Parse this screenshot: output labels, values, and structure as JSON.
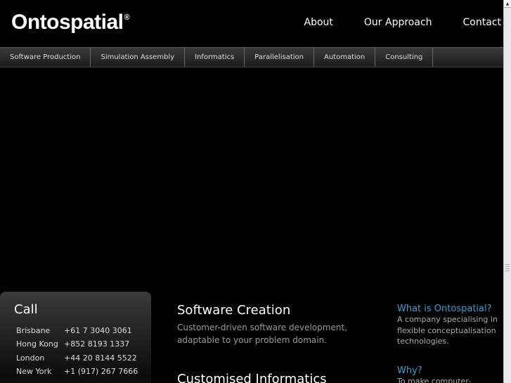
{
  "header": {
    "logo": "Ontospatial",
    "logo_mark": "®",
    "links": [
      "About",
      "Our Approach",
      "Contact"
    ]
  },
  "nav": [
    "Software Production",
    "Simulation Assembly",
    "Informatics",
    "Parallelisation",
    "Automation",
    "Consulting"
  ],
  "call": {
    "title": "Call",
    "rows": [
      {
        "city": "Brisbane",
        "phone": "+61 7 3040 3061"
      },
      {
        "city": "Hong Kong",
        "phone": "+852 8193 1337"
      },
      {
        "city": "London",
        "phone": "+44 20 8144 5522"
      },
      {
        "city": "New York",
        "phone": "+1 (917) 267 7666"
      }
    ]
  },
  "services": [
    {
      "title": "Software Creation",
      "text": "Customer-driven software development, adaptable to your problem domain."
    },
    {
      "title": "Customised Informatics"
    }
  ],
  "sidebar": {
    "what_title": "What is Ontospatial?",
    "what_text": "A company specialising in flexible conceptualisation technologies.",
    "why_title": "Why?",
    "why_text": "To make computer-"
  },
  "colors": {
    "accent": "#2ea4d0"
  }
}
